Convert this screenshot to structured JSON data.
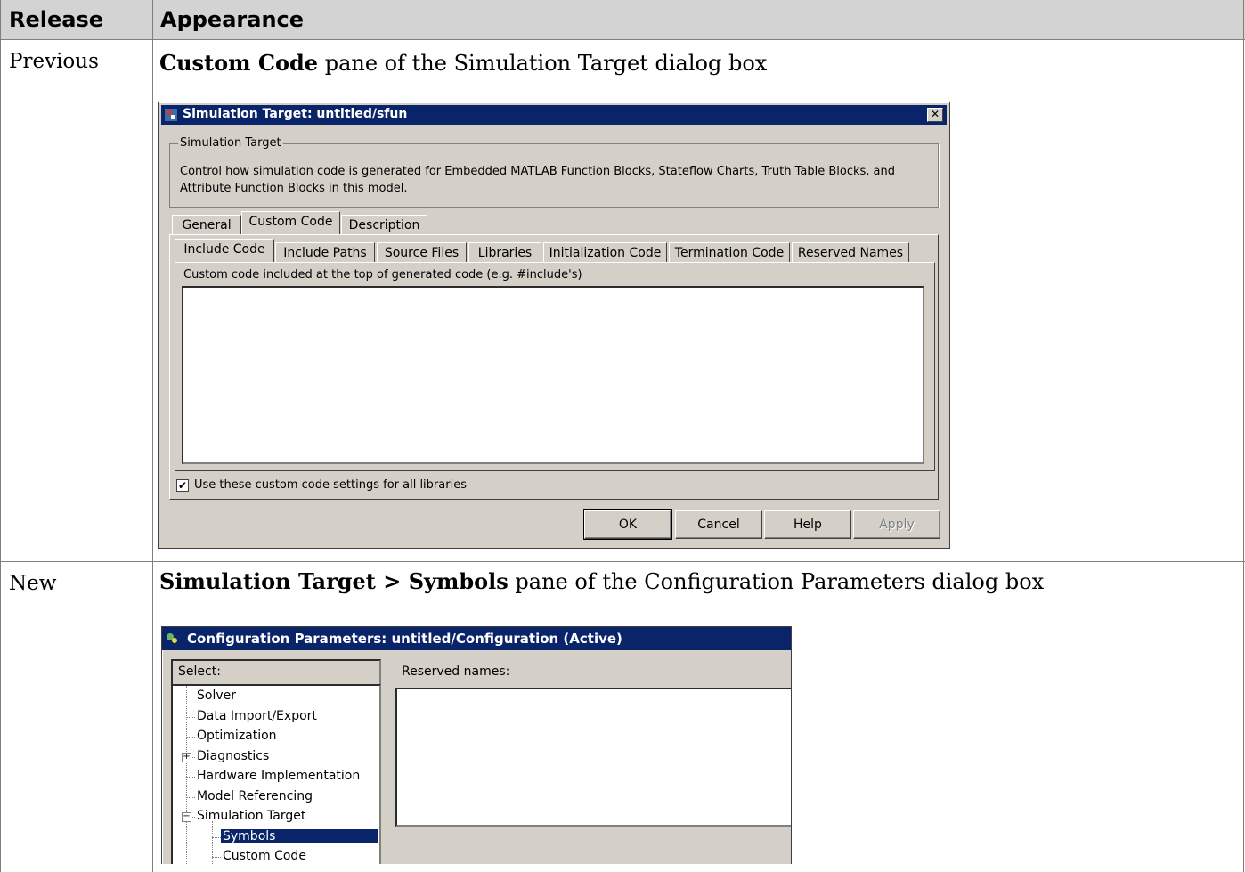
{
  "table": {
    "headers": {
      "release": "Release",
      "appearance": "Appearance"
    },
    "rows": [
      {
        "release": "Previous",
        "caption_bold": "Custom Code",
        "caption_rest": " pane of the Simulation Target dialog box"
      },
      {
        "release": "New",
        "caption_bold": "Simulation Target > Symbols",
        "caption_rest": " pane of the Configuration Parameters dialog box"
      }
    ]
  },
  "dialog1": {
    "title": "Simulation Target: untitled/sfun",
    "group_label": "Simulation Target",
    "description": "Control how simulation code is generated for Embedded MATLAB Function Blocks, Stateflow Charts, Truth Table Blocks, and Attribute Function Blocks in this model.",
    "tabs": [
      "General",
      "Custom Code",
      "Description"
    ],
    "subtabs": [
      "Include Code",
      "Include Paths",
      "Source Files",
      "Libraries",
      "Initialization Code",
      "Termination Code",
      "Reserved Names"
    ],
    "area_label": "Custom code included at the top of generated code (e.g. #include's)",
    "checkbox_label": "Use these custom code settings for all libraries",
    "checkbox_checked": true,
    "buttons": {
      "ok": "OK",
      "cancel": "Cancel",
      "help": "Help",
      "apply": "Apply"
    }
  },
  "dialog2": {
    "title": "Configuration Parameters: untitled/Configuration (Active)",
    "select_label": "Select:",
    "tree": [
      "Solver",
      "Data Import/Export",
      "Optimization",
      "Diagnostics",
      "Hardware Implementation",
      "Model Referencing",
      "Simulation Target",
      "Symbols",
      "Custom Code"
    ],
    "reserved_label": "Reserved names:"
  },
  "colors": {
    "titlebar": "#0a246a",
    "dialog_bg": "#d4d0c8",
    "header_bg": "#d3d3d3"
  },
  "icons": [
    "app-icon",
    "close-icon",
    "config-icon",
    "checkmark-icon"
  ]
}
